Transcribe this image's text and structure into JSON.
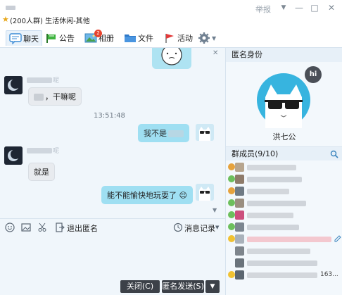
{
  "window": {
    "title": "(200人群) 生活休闲-其他",
    "report_label": "举报",
    "controls": {
      "dropdown": "▼",
      "minimize": "—",
      "maximize": "□",
      "close": "✕"
    }
  },
  "toolbar": {
    "tabs": [
      {
        "label": "聊天",
        "icon": "chat-bubble-icon"
      },
      {
        "label": "公告",
        "icon": "megaphone-icon"
      },
      {
        "label": "相册",
        "icon": "photo-album-icon"
      },
      {
        "label": "文件",
        "icon": "folder-icon"
      },
      {
        "label": "活动",
        "icon": "flag-icon"
      }
    ],
    "album_badge": "2",
    "settings_icon": "gear-icon"
  },
  "chat": {
    "messages": [
      {
        "side": "left",
        "name_tail": "呢",
        "text": "，干嘛呢"
      },
      {
        "side": "right",
        "text": "我不是"
      },
      {
        "side": "left",
        "name_tail": "呢",
        "text": "就是"
      },
      {
        "side": "right",
        "text": "能不能愉快地玩耍了",
        "emoji": "😌"
      }
    ],
    "timestamp": "13:51:48",
    "close_symbol": "✕",
    "scroll_symbol": "▼"
  },
  "input_toolbar": {
    "exit_anon": "退出匿名",
    "history": "消息记录",
    "icons": [
      "emoji-icon",
      "image-icon",
      "scissors-icon",
      "exit-anon-icon",
      "history-clock-icon"
    ]
  },
  "buttons": {
    "close": "关闭(C)",
    "anon_send": "匿名发送(S)",
    "send_arrow": "▼"
  },
  "side": {
    "anon_header": "匿名身份",
    "anon_name": "洪七公",
    "hi_badge": "hi",
    "members_header": "群成员(9/10)",
    "last_member_suffix": "163..."
  },
  "colors": {
    "accent": "#9fdff2",
    "panel_bg": "#f0f6fb",
    "dark_button": "#3c4148"
  }
}
